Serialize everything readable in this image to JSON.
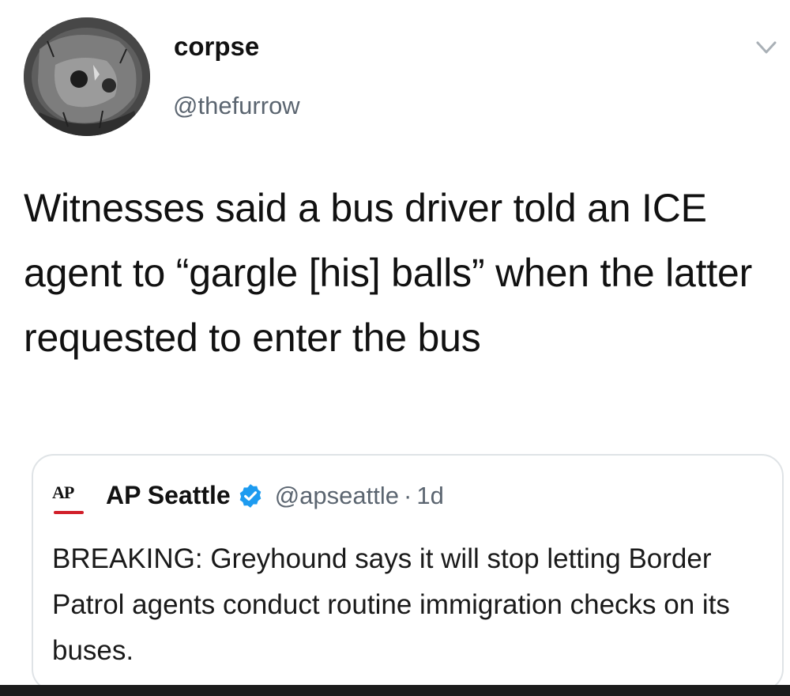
{
  "author": {
    "display_name": "corpse",
    "handle": "@thefurrow"
  },
  "tweet": {
    "text": "Witnesses said a bus driver told an ICE agent to “gargle [his] balls” when the latter requested to enter the bus"
  },
  "quoted_tweet": {
    "logo_text": "AP",
    "display_name": "AP Seattle",
    "handle": "@apseattle",
    "separator": "·",
    "time": "1d",
    "text": "BREAKING: Greyhound says it will stop letting Border Patrol agents conduct routine immigration checks on its buses."
  },
  "icons": {
    "menu": "chevron-down-icon",
    "verified": "verified-badge-icon"
  },
  "colors": {
    "verified_blue": "#1d9bf0",
    "ap_red": "#d11f2a",
    "secondary_text": "#5b6570"
  }
}
